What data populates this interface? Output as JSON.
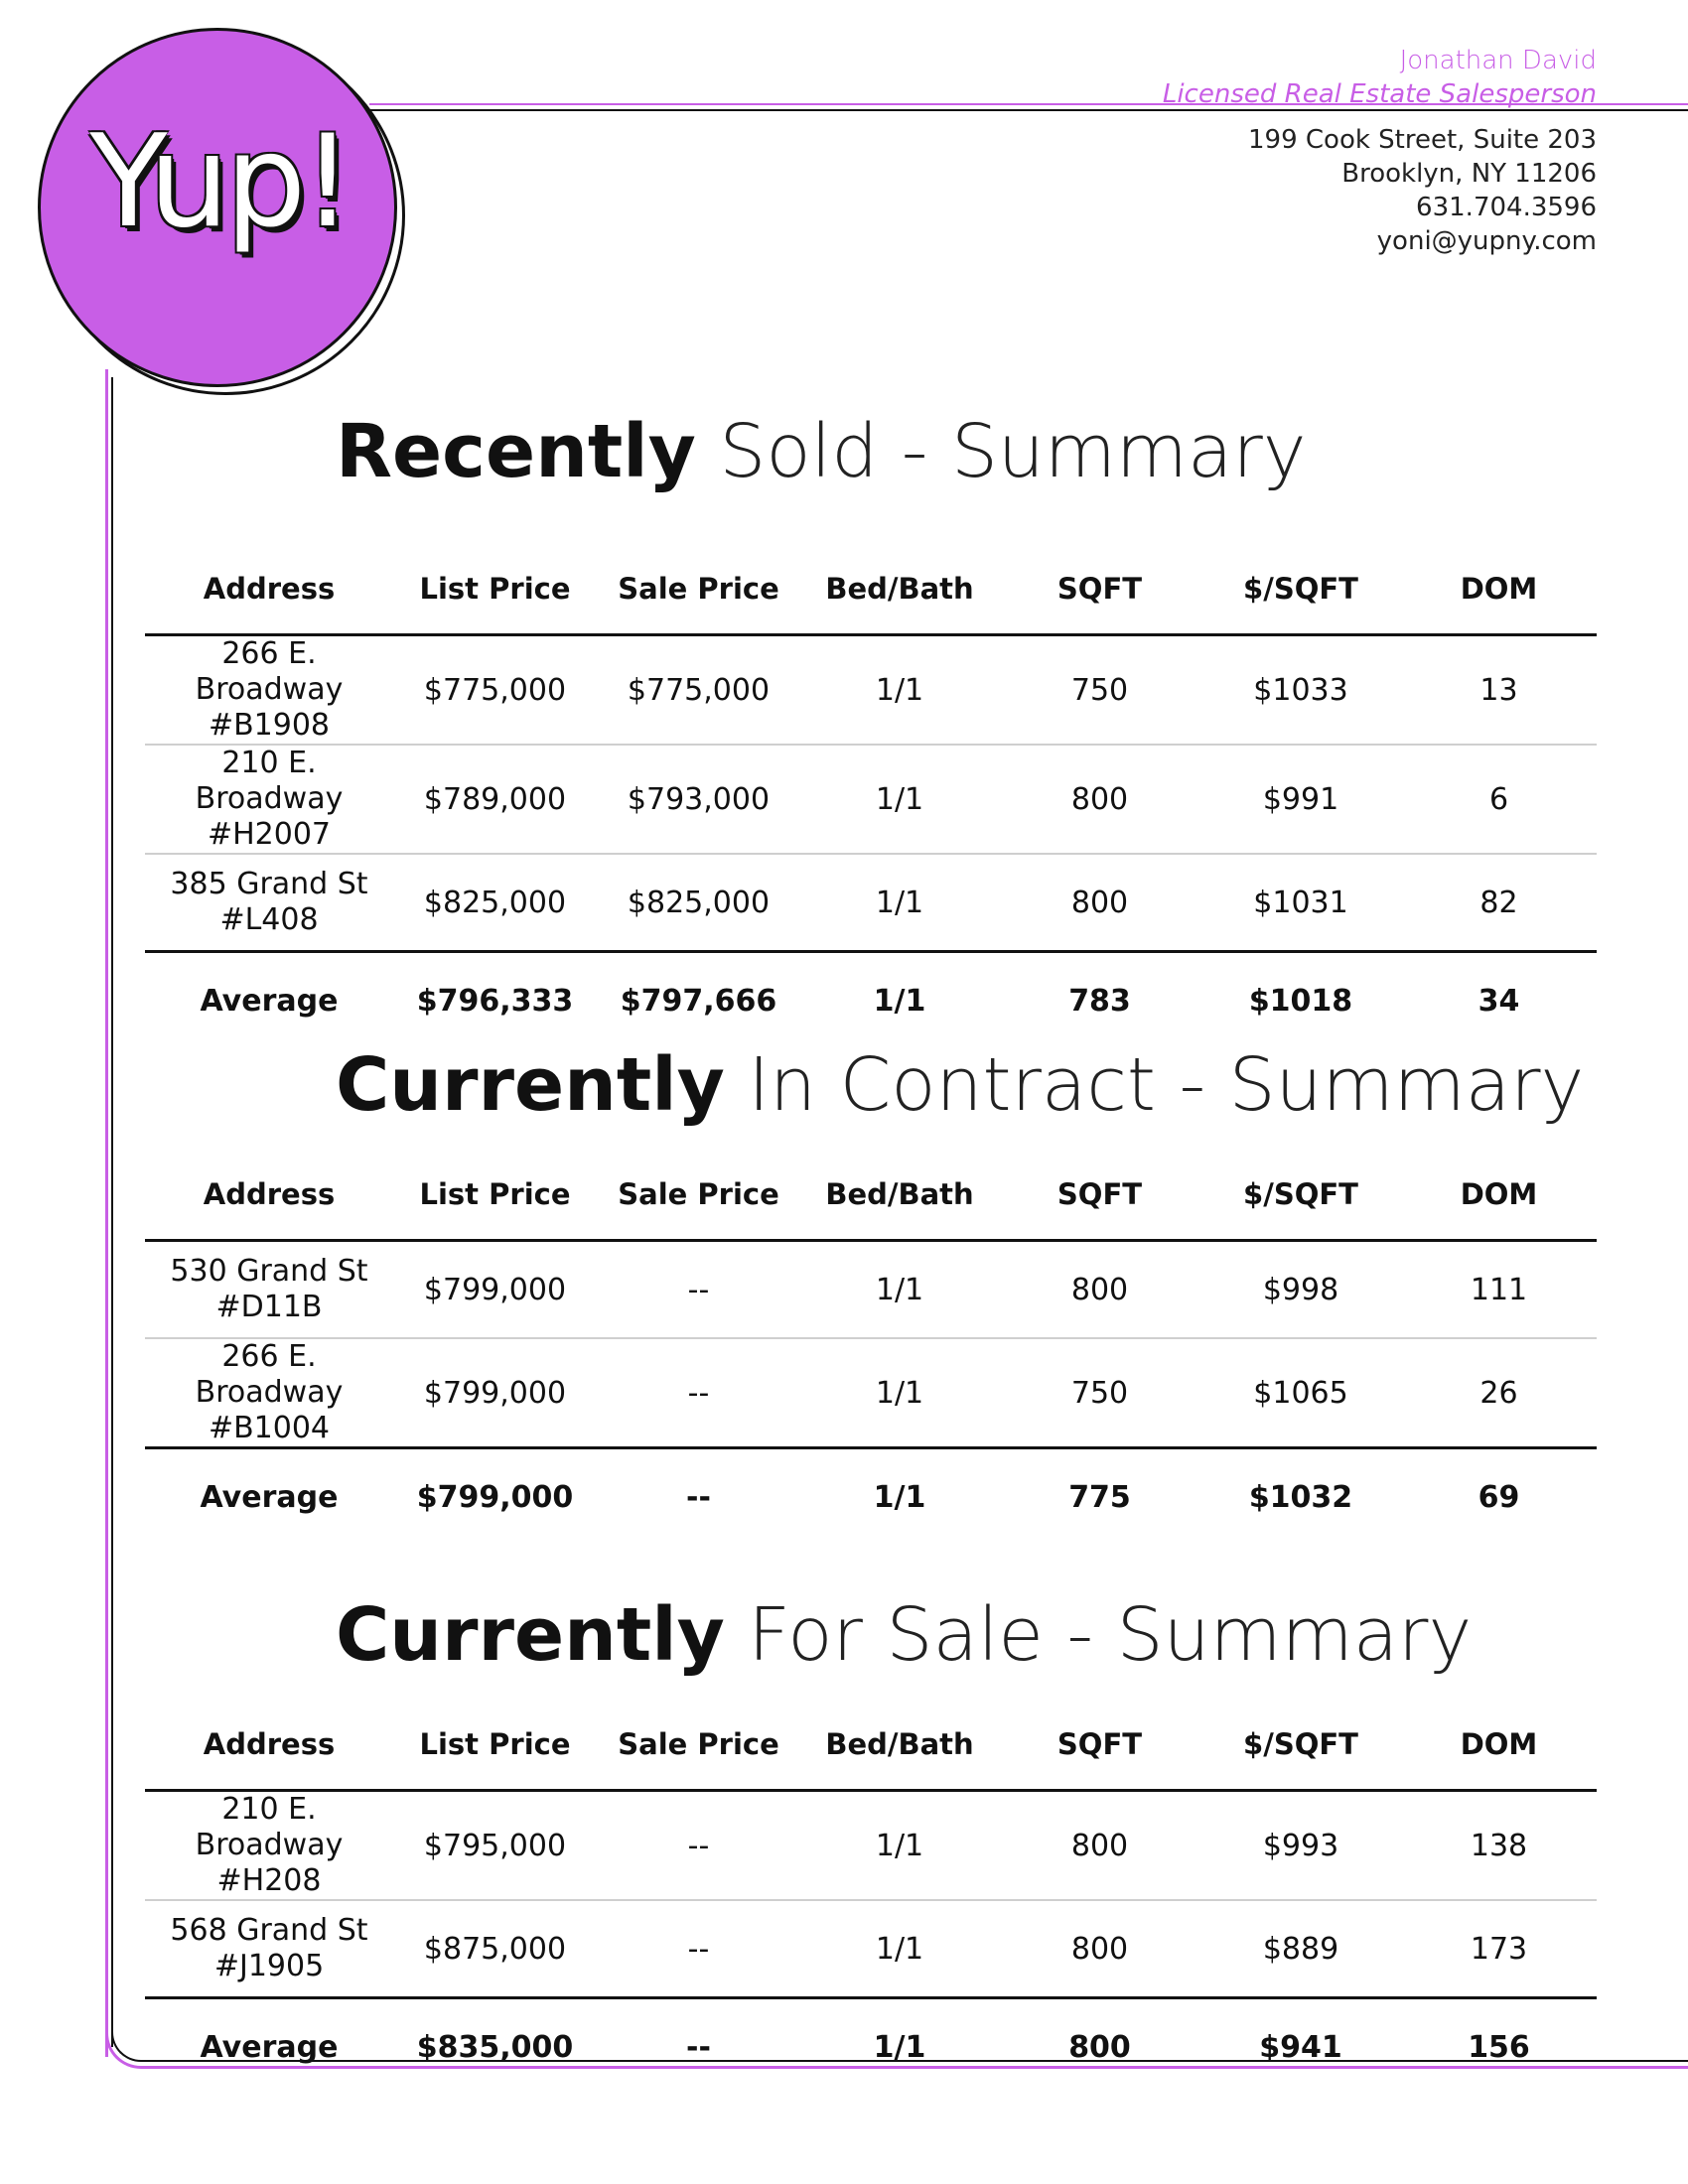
{
  "logo": {
    "text": "Yup!"
  },
  "agent": {
    "name": "Jonathan David",
    "title": "Licensed Real Estate Salesperson",
    "address_line1": "199 Cook Street, Suite 203",
    "address_line2": "Brooklyn, NY 11206",
    "phone": "631.704.3596",
    "email": "yoni@yupny.com"
  },
  "columns": [
    "Address",
    "List Price",
    "Sale Price",
    "Bed/Bath",
    "SQFT",
    "$/SQFT",
    "DOM"
  ],
  "sections": [
    {
      "title_bold": "Recently",
      "title_rest": " Sold - Summary",
      "rows": [
        {
          "address_line1": "266 E. Broadway",
          "address_line2": "#B1908",
          "list_price": "$775,000",
          "sale_price": "$775,000",
          "bed_bath": "1/1",
          "sqft": "750",
          "price_per_sqft": "$1033",
          "dom": "13"
        },
        {
          "address_line1": "210 E. Broadway",
          "address_line2": "#H2007",
          "list_price": "$789,000",
          "sale_price": "$793,000",
          "bed_bath": "1/1",
          "sqft": "800",
          "price_per_sqft": "$991",
          "dom": "6"
        },
        {
          "address_line1": "385 Grand St",
          "address_line2": "#L408",
          "list_price": "$825,000",
          "sale_price": "$825,000",
          "bed_bath": "1/1",
          "sqft": "800",
          "price_per_sqft": "$1031",
          "dom": "82"
        }
      ],
      "average": {
        "label": "Average",
        "list_price": "$796,333",
        "sale_price": "$797,666",
        "bed_bath": "1/1",
        "sqft": "783",
        "price_per_sqft": "$1018",
        "dom": "34"
      }
    },
    {
      "title_bold": "Currently",
      "title_rest": " In Contract - Summary",
      "rows": [
        {
          "address_line1": "530 Grand St",
          "address_line2": "#D11B",
          "list_price": "$799,000",
          "sale_price": "--",
          "bed_bath": "1/1",
          "sqft": "800",
          "price_per_sqft": "$998",
          "dom": "111"
        },
        {
          "address_line1": "266 E. Broadway",
          "address_line2": "#B1004",
          "list_price": "$799,000",
          "sale_price": "--",
          "bed_bath": "1/1",
          "sqft": "750",
          "price_per_sqft": "$1065",
          "dom": "26"
        }
      ],
      "average": {
        "label": "Average",
        "list_price": "$799,000",
        "sale_price": "--",
        "bed_bath": "1/1",
        "sqft": "775",
        "price_per_sqft": "$1032",
        "dom": "69"
      }
    },
    {
      "title_bold": "Currently",
      "title_rest": " For Sale - Summary",
      "rows": [
        {
          "address_line1": "210 E. Broadway",
          "address_line2": "#H208",
          "list_price": "$795,000",
          "sale_price": "--",
          "bed_bath": "1/1",
          "sqft": "800",
          "price_per_sqft": "$993",
          "dom": "138"
        },
        {
          "address_line1": "568 Grand St",
          "address_line2": "#J1905",
          "list_price": "$875,000",
          "sale_price": "--",
          "bed_bath": "1/1",
          "sqft": "800",
          "price_per_sqft": "$889",
          "dom": "173"
        }
      ],
      "average": {
        "label": "Average",
        "list_price": "$835,000",
        "sale_price": "--",
        "bed_bath": "1/1",
        "sqft": "800",
        "price_per_sqft": "$941",
        "dom": "156"
      }
    }
  ]
}
